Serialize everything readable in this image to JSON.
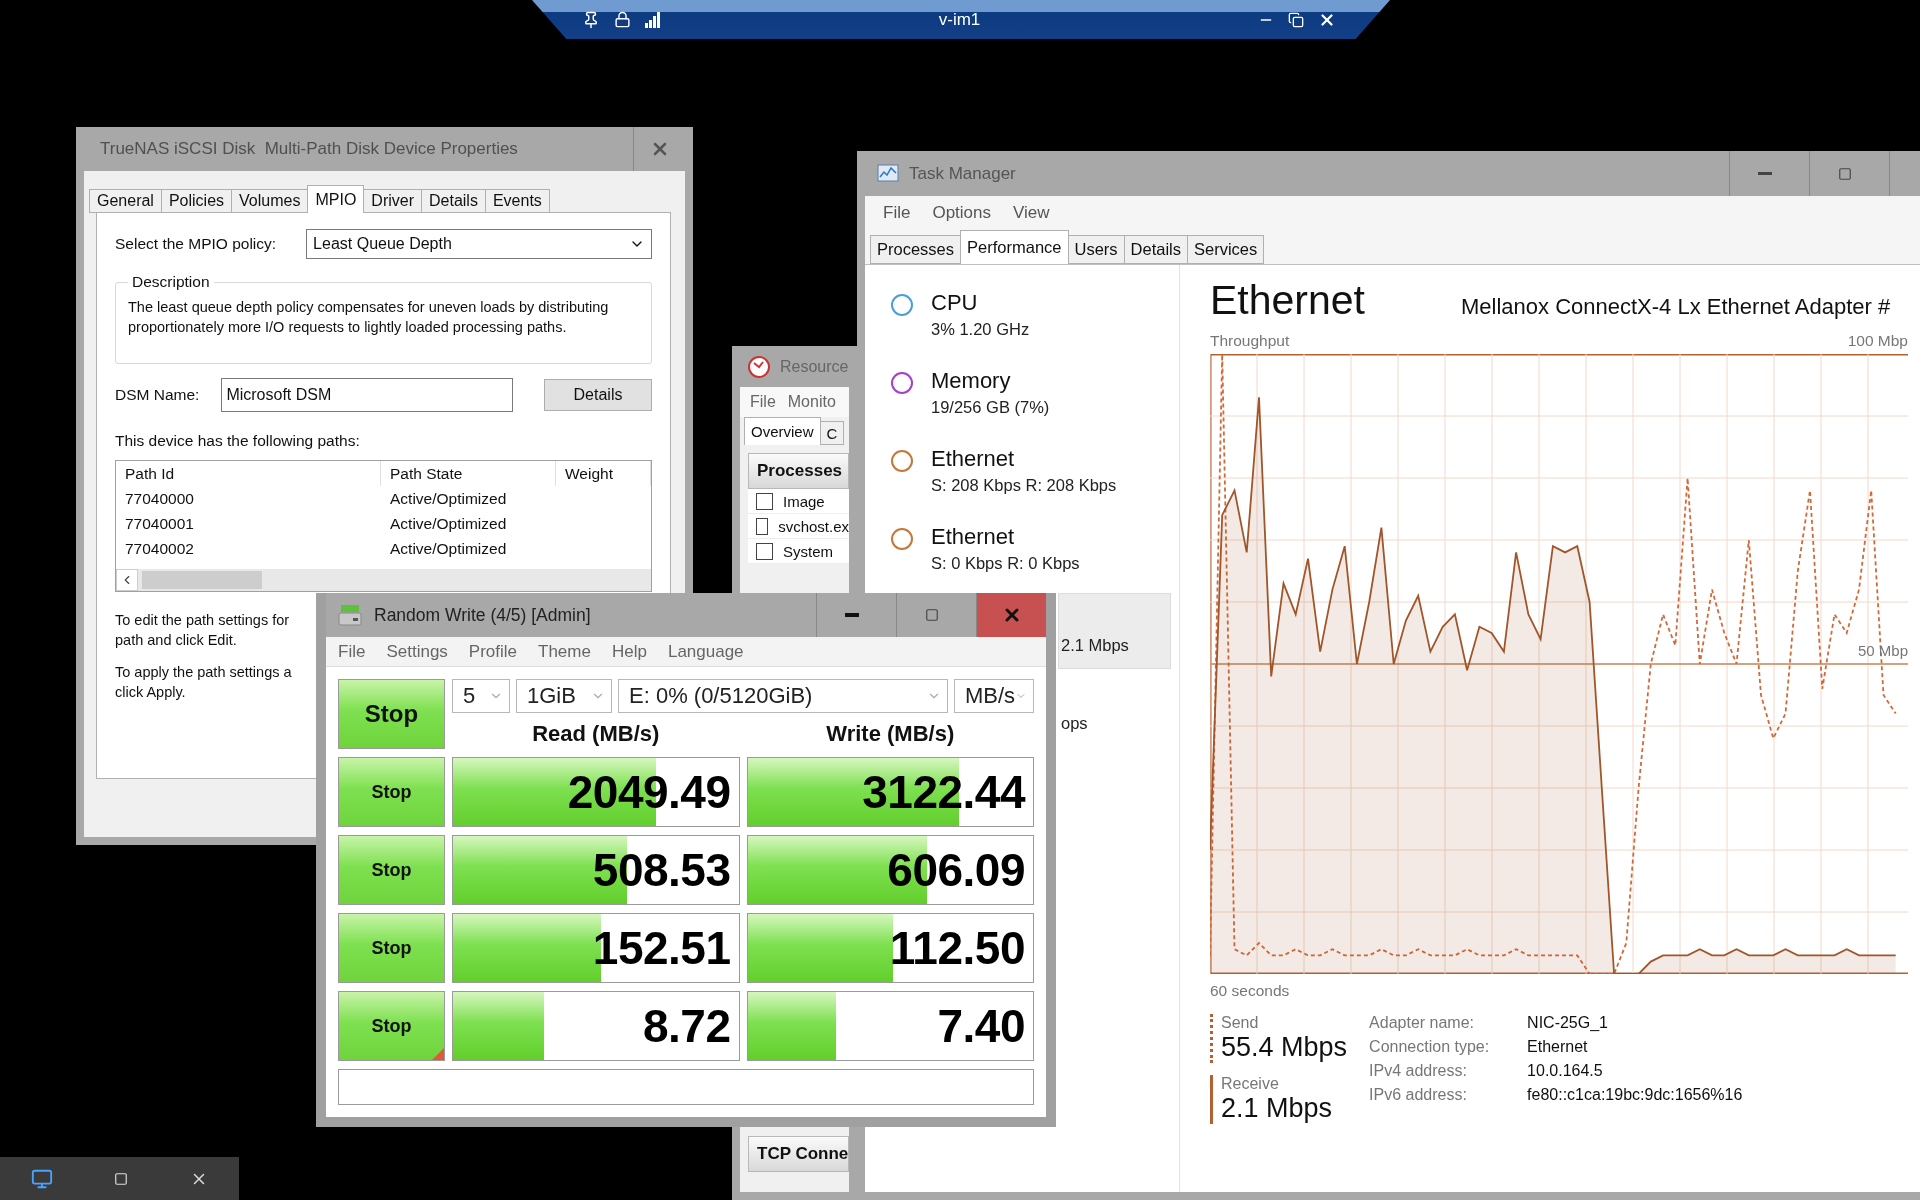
{
  "remote_bar": {
    "title": "v-im1"
  },
  "mpio_dialog": {
    "title": "TrueNAS iSCSI Disk  Multi-Path Disk Device Properties",
    "tabs": [
      {
        "label": "General",
        "selected": false
      },
      {
        "label": "Policies",
        "selected": false
      },
      {
        "label": "Volumes",
        "selected": false
      },
      {
        "label": "MPIO",
        "selected": true
      },
      {
        "label": "Driver",
        "selected": false
      },
      {
        "label": "Details",
        "selected": false
      },
      {
        "label": "Events",
        "selected": false
      }
    ],
    "policy_label": "Select the MPIO policy:",
    "policy": "Least Queue Depth",
    "description_legend": "Description",
    "description": "The least queue depth policy compensates for uneven loads by distributing proportionately more I/O requests to lightly loaded processing paths.",
    "dsm_label": "DSM Name:",
    "dsm_name": "Microsoft DSM",
    "details_button": "Details",
    "paths_label": "This device has the following paths:",
    "paths_table": {
      "columns": [
        "Path Id",
        "Path State",
        "Weight"
      ],
      "rows": [
        [
          "77040000",
          "Active/Optimized"
        ],
        [
          "77040001",
          "Active/Optimized"
        ],
        [
          "77040002",
          "Active/Optimized"
        ]
      ]
    },
    "notes": [
      [
        "To edit the path settings for",
        "path and click Edit."
      ],
      [
        "To apply the path settings a",
        "click Apply."
      ]
    ]
  },
  "resource_monitor": {
    "title": "Resource",
    "menu": [
      "File",
      "Monito"
    ],
    "tabs": [
      {
        "label": "Overview",
        "selected": true
      },
      {
        "label": "C",
        "selected": false
      }
    ],
    "section": "Processes",
    "rows": [
      {
        "label": "Image",
        "checked": false
      },
      {
        "label": "svchost.ex",
        "checked": false
      },
      {
        "label": "System",
        "checked": false
      }
    ],
    "section_2": "TCP Conne"
  },
  "task_manager": {
    "title": "Task Manager",
    "menu": [
      "File",
      "Options",
      "View"
    ],
    "tabs": [
      {
        "label": "Processes",
        "selected": false
      },
      {
        "label": "Performance",
        "selected": true
      },
      {
        "label": "Users",
        "selected": false
      },
      {
        "label": "Details",
        "selected": false
      },
      {
        "label": "Services",
        "selected": false
      }
    ],
    "resources": [
      {
        "name": "CPU",
        "detail": "3%  1.20 GHz",
        "color": "#4a9fd8",
        "selected": false
      },
      {
        "name": "Memory",
        "detail": "19/256 GB (7%)",
        "color": "#a43fcf",
        "selected": false
      },
      {
        "name": "Ethernet",
        "detail": "S: 208 Kbps R: 208 Kbps",
        "color": "#c4783a",
        "selected": false
      },
      {
        "name": "Ethernet",
        "detail": "S: 0 Kbps R: 0 Kbps",
        "color": "#c4783a",
        "selected": false
      },
      {
        "detail": "2.1 Mbps",
        "selected": true
      },
      {
        "detail": "ops",
        "selected": false
      }
    ],
    "performance": {
      "title": "Ethernet",
      "adapter": "Mellanox ConnectX-4 Lx Ethernet Adapter #",
      "graph": {
        "title": "Throughput",
        "max_label": "100 Mbp",
        "mid_label": "50 Mbp",
        "time_label": "60 seconds"
      },
      "send": {
        "label": "Send",
        "value": "55.4 Mbps"
      },
      "receive": {
        "label": "Receive",
        "value": "2.1 Mbps"
      },
      "properties": [
        {
          "label": "Adapter name:",
          "value": "NIC-25G_1"
        },
        {
          "label": "Connection type:",
          "value": "Ethernet"
        },
        {
          "label": "IPv4 address:",
          "value": "10.0.164.5"
        },
        {
          "label": "IPv6 address:",
          "value": "fe80::c1ca:19bc:9dc:1656%16"
        }
      ]
    }
  },
  "disk_mark": {
    "title": "Random Write (4/5) [Admin]",
    "menu": [
      "File",
      "Settings",
      "Profile",
      "Theme",
      "Help",
      "Language"
    ],
    "main_button": "Stop",
    "count": "5",
    "size": "1GiB",
    "drive": "E: 0% (0/5120GiB)",
    "unit": "MB/s",
    "read_header": "Read (MB/s)",
    "write_header": "Write (MB/s)",
    "tests": [
      {
        "button": "Stop",
        "running": false,
        "read": {
          "value": "2049.49",
          "level": 0.71
        },
        "write": {
          "value": "3122.44",
          "level": 0.74
        }
      },
      {
        "button": "Stop",
        "running": false,
        "read": {
          "value": "508.53",
          "level": 0.61
        },
        "write": {
          "value": "606.09",
          "level": 0.63
        }
      },
      {
        "button": "Stop",
        "running": false,
        "read": {
          "value": "152.51",
          "level": 0.52
        },
        "write": {
          "value": "112.50",
          "level": 0.51
        }
      },
      {
        "button": "Stop",
        "running": true,
        "read": {
          "value": "8.72",
          "level": 0.32
        },
        "write": {
          "value": "7.40",
          "level": 0.31
        }
      }
    ]
  }
}
